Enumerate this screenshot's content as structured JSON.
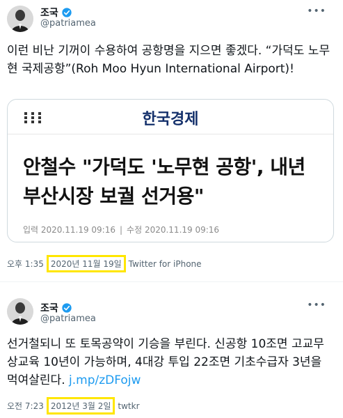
{
  "tweets": [
    {
      "author_name": "조국",
      "handle": "@patriamea",
      "text": "이런 비난 기꺼이 수용하여 공항명을 지으면 좋겠다. “가덕도 노무현 국제공항”(Roh Moo Hyun International Airport)!",
      "card": {
        "publisher": "한국경제",
        "headline": "안철수 \"가덕도 '노무현 공항', 내년 부산시장 보궐 선거용\"",
        "published": "입력 2020.11.19 09:16",
        "modified": "수정 2020.11.19 09:16"
      },
      "time": "오후 1:35",
      "date": "2020년 11월 19일",
      "source": "Twitter for iPhone"
    },
    {
      "author_name": "조국",
      "handle": "@patriamea",
      "text": "선거철되니 또 토목공약이 기승을 부린다. 신공항 10조면 고교무상교육 10년이 가능하며, 4대강 투입 22조면 기초수급자 3년을 먹여살린다.",
      "link": "j.mp/zDFojw",
      "time": "오전 7:23",
      "date": "2012년 3월 2일",
      "source": "twtkr"
    }
  ],
  "colors": {
    "highlight": "#ffe600",
    "link": "#1d9bf0",
    "verified": "#1d9bf0",
    "publisher": "#14306b"
  },
  "icons": [
    "verified-badge-icon",
    "more-options-icon",
    "menu-grid-icon"
  ]
}
